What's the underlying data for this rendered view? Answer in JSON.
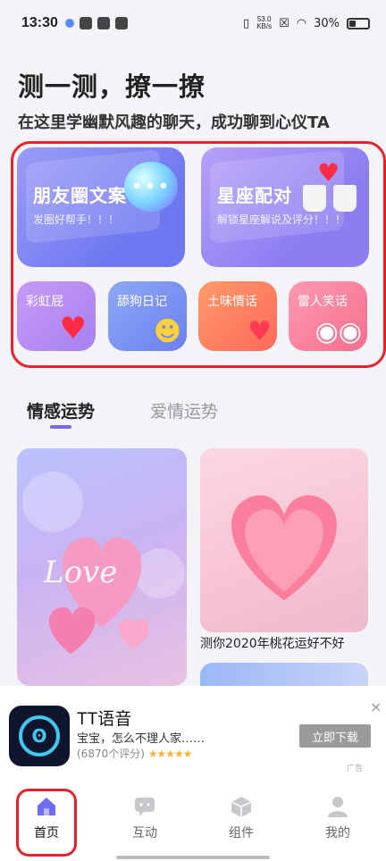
{
  "status_bar": {
    "time": "13:30",
    "net_speed_top": "53.0",
    "net_speed_bottom": "KB/s",
    "battery": "30%"
  },
  "header": {
    "title": "测一测，撩一撩",
    "subtitle": "在这里学幽默风趣的聊天，成功聊到心仪TA"
  },
  "feature_cards": {
    "big": [
      {
        "title": "朋友圈文案",
        "subtitle": "发圈好帮手！！！",
        "icon": "chat-bubble-icon"
      },
      {
        "title": "星座配对",
        "subtitle": "解锁星座解说及评分！！！",
        "icon": "coffee-mugs-icon"
      }
    ],
    "small": [
      {
        "title": "彩虹屁",
        "icon": "hand-heart-icon"
      },
      {
        "title": "舔狗日记",
        "icon": "phone-emoji-icon"
      },
      {
        "title": "土味情话",
        "icon": "heart-chat-icon"
      },
      {
        "title": "雷人笑话",
        "icon": "googly-eyes-icon"
      }
    ]
  },
  "tabs": [
    {
      "label": "情感运势",
      "active": true
    },
    {
      "label": "爱情运势",
      "active": false
    }
  ],
  "feed": {
    "right_caption": "测你2020年桃花运好不好"
  },
  "ad": {
    "app_name": "TT语音",
    "description": "宝宝，怎么不理人家……",
    "rating_text": "(6870个评分)",
    "stars": "★★★★★",
    "button": "立即下载",
    "close": "×",
    "tag": "广告"
  },
  "nav": [
    {
      "label": "首页",
      "active": true,
      "icon": "home-icon"
    },
    {
      "label": "互动",
      "active": false,
      "icon": "chat-icon"
    },
    {
      "label": "组件",
      "active": false,
      "icon": "cube-icon"
    },
    {
      "label": "我的",
      "active": false,
      "icon": "user-icon"
    }
  ],
  "colors": {
    "accent": "#7766ee",
    "highlight_red": "#e8222a"
  }
}
